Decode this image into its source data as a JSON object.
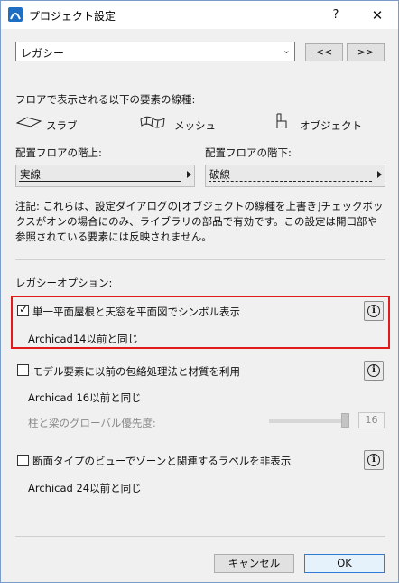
{
  "window": {
    "title": "プロジェクト設定",
    "help_label": "?",
    "close_label": "✕"
  },
  "preset": {
    "value": "レガシー",
    "prev_label": "<<",
    "next_label": ">>"
  },
  "linetype_section": {
    "heading": "フロアで表示される以下の要素の線種:",
    "elements": [
      {
        "label": "スラブ",
        "icon": "slab-icon"
      },
      {
        "label": "メッシュ",
        "icon": "mesh-icon"
      },
      {
        "label": "オブジェクト",
        "icon": "object-chair-icon"
      }
    ],
    "above": {
      "label": "配置フロアの階上:",
      "value": "実線"
    },
    "below": {
      "label": "配置フロアの階下:",
      "value": "破線"
    }
  },
  "note": "注記: これらは、設定ダイアログの[オブジェクトの線種を上書き]チェックボックスがオンの場合にのみ、ライブラリの部品で有効です。この設定は開口部や参照されている要素には反映されません。",
  "legacy": {
    "heading": "レガシーオプション:",
    "options": [
      {
        "label": "単一平面屋根と天窓を平面図でシンボル表示",
        "checked": true,
        "sub": "Archicad14以前と同じ"
      },
      {
        "label": "モデル要素に以前の包絡処理法と材質を利用",
        "checked": false,
        "sub": "Archicad 16以前と同じ"
      },
      {
        "label": "断面タイプのビューでゾーンと関連するラベルを非表示",
        "checked": false,
        "sub": "Archicad 24以前と同じ"
      }
    ],
    "priority": {
      "label": "柱と梁のグローバル優先度:",
      "value": 16
    }
  },
  "footer": {
    "cancel_label": "キャンセル",
    "ok_label": "OK"
  },
  "colors": {
    "highlight": "#e11b1b",
    "accent": "#2f7cd6",
    "app_icon": "#1e6fc4"
  }
}
